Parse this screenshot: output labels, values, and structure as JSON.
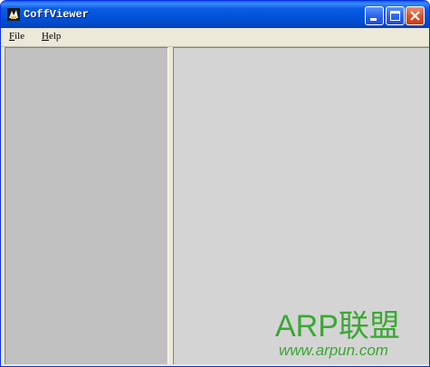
{
  "window": {
    "title": "CoffViewer",
    "icon": "app-icon"
  },
  "menu": {
    "file": {
      "accel": "F",
      "rest": "ile"
    },
    "help": {
      "accel": "H",
      "rest": "elp"
    }
  },
  "watermark": {
    "main": "ARP联盟",
    "url": "www.arpun.com"
  },
  "colors": {
    "titlebar": "#0052d8",
    "window_bg": "#ece9d8",
    "left_pane": "#c0c0c0",
    "right_pane": "#d4d4d4",
    "watermark": "#3aa832"
  }
}
